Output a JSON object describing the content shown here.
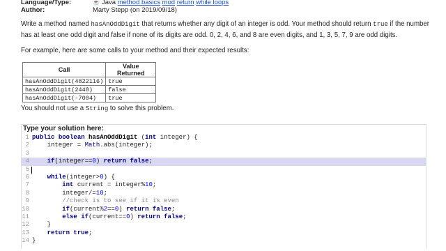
{
  "meta": {
    "language_key": "Language/Type:",
    "java_icon": "java-cup-icon",
    "language_value": "Java",
    "tags": [
      "method basics",
      "mod",
      "return",
      "while loops"
    ],
    "author_key": "Author:",
    "author_value": "Marty Stepp (on 2019/09/18)"
  },
  "description": {
    "p1_a": "Write a method named ",
    "p1_method": "hasAnOddDigit",
    "p1_b": " that returns whether any digit of an integer is odd. Your method should return ",
    "p1_true": "true",
    "p1_c": " if the number has at least one odd digit and false if none of its digits are odd. 0, 2, 4, 6, and 8 are even digits, and 1, 3, 5, 7, 9 are odd digits."
  },
  "example_intro": "For example, here are some calls to your method and their expected results:",
  "table": {
    "headers": [
      "Call",
      "Value Returned"
    ],
    "rows": [
      [
        "hasAnOddDigit(4822116)",
        "true"
      ],
      [
        "hasAnOddDigit(2448)",
        "false"
      ],
      [
        "hasAnOddDigit(-7004)",
        "true"
      ]
    ]
  },
  "no_string": {
    "a": "You should not use a ",
    "code": "String",
    "b": " to solve this problem."
  },
  "solution_label": "Type your solution here:",
  "code": {
    "lines": [
      "1",
      "2",
      "3",
      "4",
      "5",
      "6",
      "7",
      "8",
      "9",
      "10",
      "11",
      "12",
      "13",
      "14"
    ],
    "highlighted_line": 4,
    "cursor_line": 5
  }
}
